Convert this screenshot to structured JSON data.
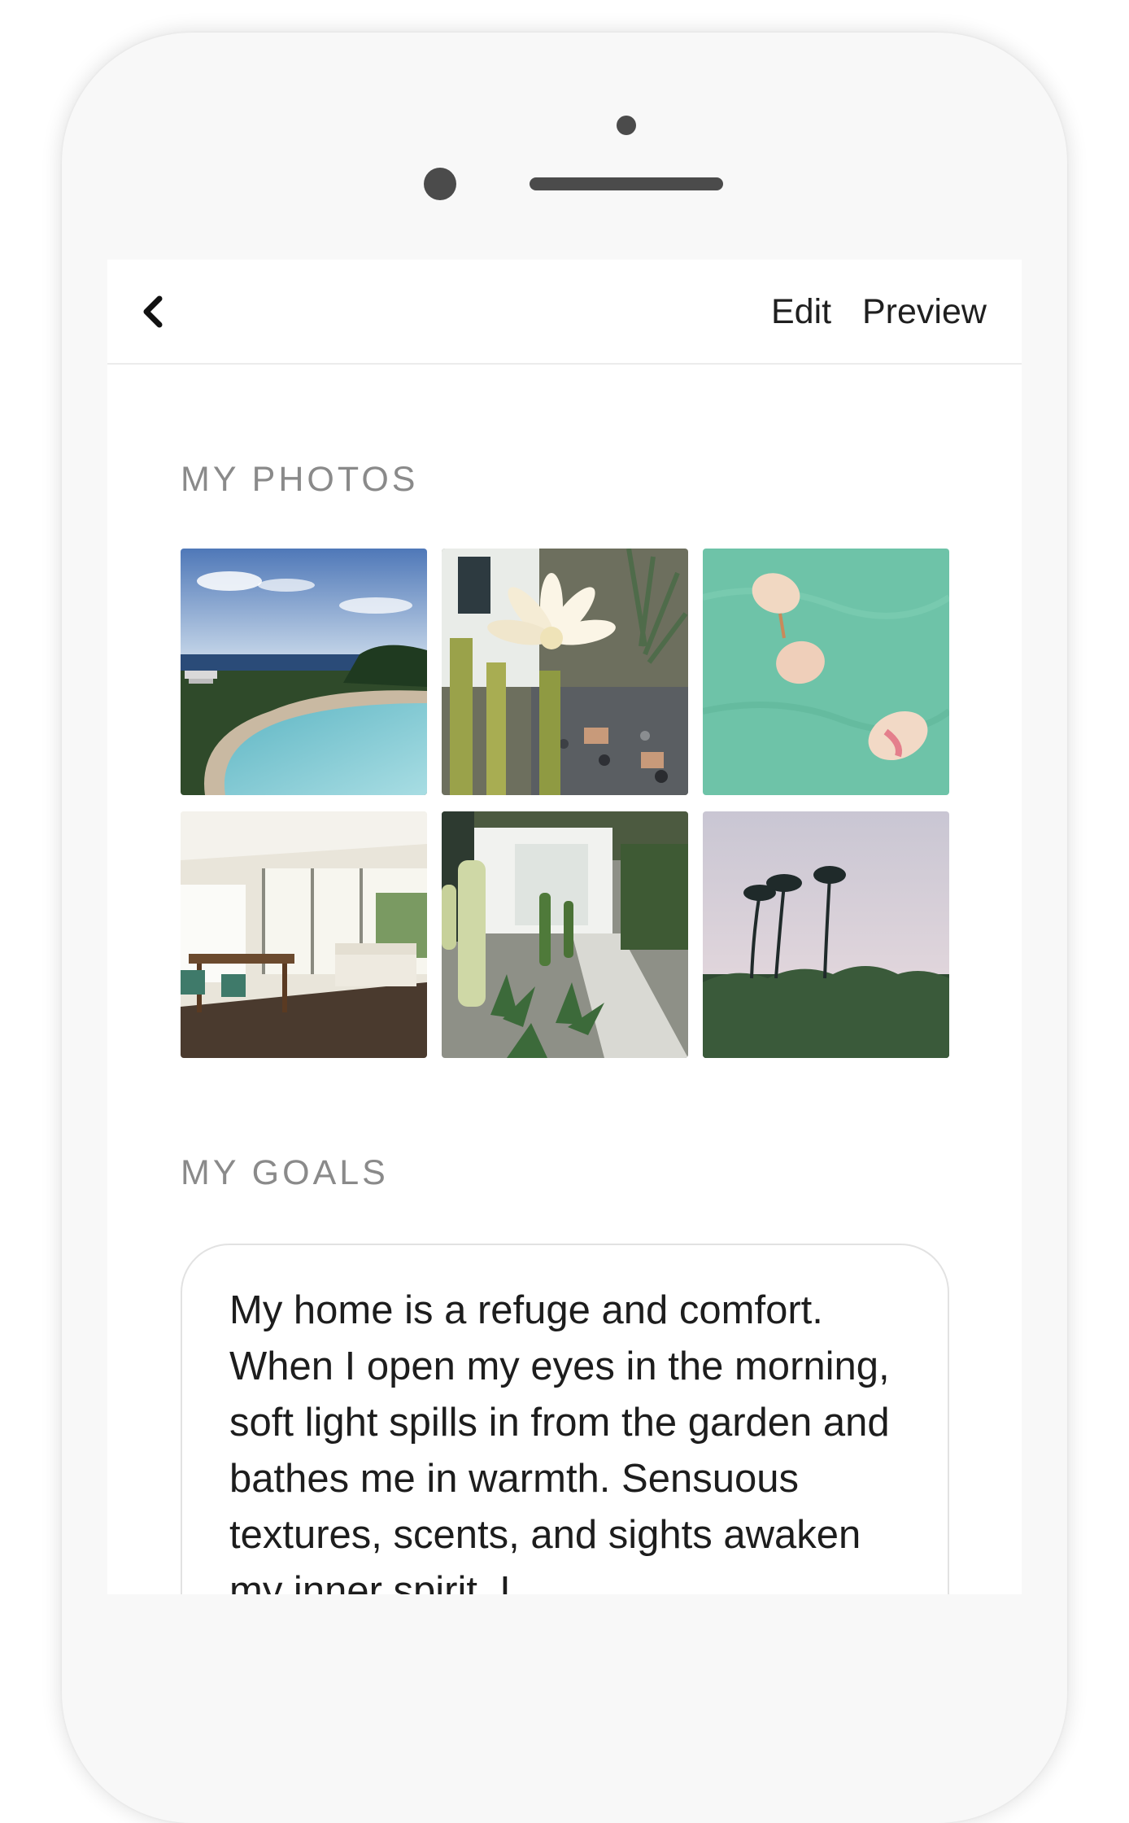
{
  "header": {
    "back_icon": "chevron-left-icon",
    "edit_label": "Edit",
    "preview_label": "Preview"
  },
  "photos": {
    "title": "MY PHOTOS",
    "items": [
      {
        "subject": "pool-ocean-view"
      },
      {
        "subject": "white-cactus-flower"
      },
      {
        "subject": "petals-on-water"
      },
      {
        "subject": "sunlit-dining-room"
      },
      {
        "subject": "cactus-garden-path"
      },
      {
        "subject": "palm-trees-dusk"
      }
    ]
  },
  "goals": {
    "title": "MY GOALS",
    "text": "My home is a refuge and comfort. When I open my eyes in the morning, soft light spills in from the garden and bathes me in warmth. Sensuous textures, scents, and sights awaken my inner spirit. I"
  },
  "colors": {
    "phone_body": "#f8f8f8",
    "section_title": "#8a8a8a",
    "text": "#1d1d1d"
  }
}
